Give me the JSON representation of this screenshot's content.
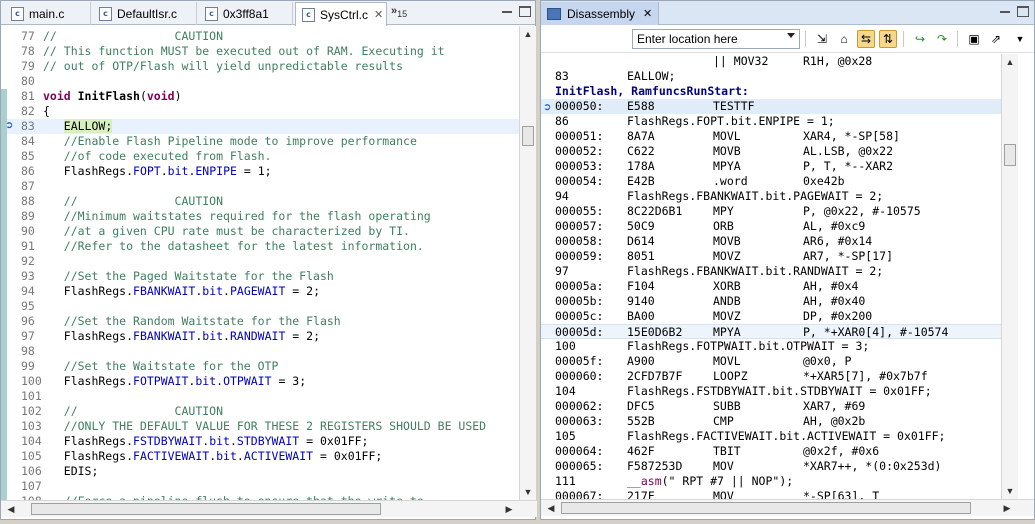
{
  "left_tabs": [
    {
      "label": "main.c",
      "icon": "c-file-icon"
    },
    {
      "label": "DefaultIsr.c",
      "icon": "c-file-icon"
    },
    {
      "label": "0x3ff8a1",
      "icon": "c-file-icon"
    },
    {
      "label": "SysCtrl.c",
      "icon": "c-file-icon",
      "active": true
    }
  ],
  "overflow_tabs": {
    "chevron": "»",
    "count": "15"
  },
  "source_lines": [
    {
      "n": "77",
      "parts": [
        {
          "t": "//                 CAUTION",
          "c": "c-comment"
        }
      ]
    },
    {
      "n": "78",
      "parts": [
        {
          "t": "// This function MUST be executed out of RAM. Executing it",
          "c": "c-comment"
        }
      ]
    },
    {
      "n": "79",
      "parts": [
        {
          "t": "// out of OTP/Flash will yield unpredictable results",
          "c": "c-comment"
        }
      ]
    },
    {
      "n": "80",
      "parts": []
    },
    {
      "n": "81",
      "parts": [
        {
          "t": "void ",
          "c": "c-bold"
        },
        {
          "t": "InitFlash",
          "c": "c-plain c-b"
        },
        {
          "t": "(",
          "c": "c-plain"
        },
        {
          "t": "void",
          "c": "c-bold"
        },
        {
          "t": ")",
          "c": "c-plain"
        }
      ]
    },
    {
      "n": "82",
      "parts": [
        {
          "t": "{",
          "c": "c-plain"
        }
      ]
    },
    {
      "n": "83",
      "parts": [
        {
          "t": "   ",
          "c": "c-plain"
        },
        {
          "t": "EALLOW;",
          "c": "c-plain eallow-hl"
        }
      ],
      "current": true
    },
    {
      "n": "84",
      "parts": [
        {
          "t": "   //Enable Flash Pipeline mode to improve performance",
          "c": "c-comment"
        }
      ]
    },
    {
      "n": "85",
      "parts": [
        {
          "t": "   //of code executed from Flash.",
          "c": "c-comment"
        }
      ]
    },
    {
      "n": "86",
      "parts": [
        {
          "t": "   FlashRegs.",
          "c": "c-plain"
        },
        {
          "t": "FOPT",
          "c": "c-field"
        },
        {
          "t": ".",
          "c": "c-plain"
        },
        {
          "t": "bit",
          "c": "c-field"
        },
        {
          "t": ".",
          "c": "c-plain"
        },
        {
          "t": "ENPIPE",
          "c": "c-field"
        },
        {
          "t": " = 1;",
          "c": "c-plain"
        }
      ]
    },
    {
      "n": "87",
      "parts": []
    },
    {
      "n": "88",
      "parts": [
        {
          "t": "   //              CAUTION",
          "c": "c-comment"
        }
      ]
    },
    {
      "n": "89",
      "parts": [
        {
          "t": "   //Minimum waitstates required for the flash operating",
          "c": "c-comment"
        }
      ]
    },
    {
      "n": "90",
      "parts": [
        {
          "t": "   //at a given CPU rate must be characterized by TI.",
          "c": "c-comment"
        }
      ]
    },
    {
      "n": "91",
      "parts": [
        {
          "t": "   //Refer to the datasheet for the latest information.",
          "c": "c-comment"
        }
      ]
    },
    {
      "n": "92",
      "parts": []
    },
    {
      "n": "93",
      "parts": [
        {
          "t": "   //Set the Paged Waitstate for the Flash",
          "c": "c-comment"
        }
      ]
    },
    {
      "n": "94",
      "parts": [
        {
          "t": "   FlashRegs.",
          "c": "c-plain"
        },
        {
          "t": "FBANKWAIT",
          "c": "c-field"
        },
        {
          "t": ".",
          "c": "c-plain"
        },
        {
          "t": "bit",
          "c": "c-field"
        },
        {
          "t": ".",
          "c": "c-plain"
        },
        {
          "t": "PAGEWAIT",
          "c": "c-field"
        },
        {
          "t": " = 2;",
          "c": "c-plain"
        }
      ]
    },
    {
      "n": "95",
      "parts": []
    },
    {
      "n": "96",
      "parts": [
        {
          "t": "   //Set the Random Waitstate for the Flash",
          "c": "c-comment"
        }
      ]
    },
    {
      "n": "97",
      "parts": [
        {
          "t": "   FlashRegs.",
          "c": "c-plain"
        },
        {
          "t": "FBANKWAIT",
          "c": "c-field"
        },
        {
          "t": ".",
          "c": "c-plain"
        },
        {
          "t": "bit",
          "c": "c-field"
        },
        {
          "t": ".",
          "c": "c-plain"
        },
        {
          "t": "RANDWAIT",
          "c": "c-field"
        },
        {
          "t": " = 2;",
          "c": "c-plain"
        }
      ]
    },
    {
      "n": "98",
      "parts": []
    },
    {
      "n": "99",
      "parts": [
        {
          "t": "   //Set the Waitstate for the OTP",
          "c": "c-comment"
        }
      ]
    },
    {
      "n": "100",
      "parts": [
        {
          "t": "   FlashRegs.",
          "c": "c-plain"
        },
        {
          "t": "FOTPWAIT",
          "c": "c-field"
        },
        {
          "t": ".",
          "c": "c-plain"
        },
        {
          "t": "bit",
          "c": "c-field"
        },
        {
          "t": ".",
          "c": "c-plain"
        },
        {
          "t": "OTPWAIT",
          "c": "c-field"
        },
        {
          "t": " = 3;",
          "c": "c-plain"
        }
      ]
    },
    {
      "n": "101",
      "parts": []
    },
    {
      "n": "102",
      "parts": [
        {
          "t": "   //              CAUTION",
          "c": "c-comment"
        }
      ]
    },
    {
      "n": "103",
      "parts": [
        {
          "t": "   //ONLY THE DEFAULT VALUE FOR THESE 2 REGISTERS SHOULD BE USED",
          "c": "c-comment"
        }
      ]
    },
    {
      "n": "104",
      "parts": [
        {
          "t": "   FlashRegs.",
          "c": "c-plain"
        },
        {
          "t": "FSTDBYWAIT",
          "c": "c-field"
        },
        {
          "t": ".",
          "c": "c-plain"
        },
        {
          "t": "bit",
          "c": "c-field"
        },
        {
          "t": ".",
          "c": "c-plain"
        },
        {
          "t": "STDBYWAIT",
          "c": "c-field"
        },
        {
          "t": " = 0x01FF;",
          "c": "c-plain"
        }
      ]
    },
    {
      "n": "105",
      "parts": [
        {
          "t": "   FlashRegs.",
          "c": "c-plain"
        },
        {
          "t": "FACTIVEWAIT",
          "c": "c-field"
        },
        {
          "t": ".",
          "c": "c-plain"
        },
        {
          "t": "bit",
          "c": "c-field"
        },
        {
          "t": ".",
          "c": "c-plain"
        },
        {
          "t": "ACTIVEWAIT",
          "c": "c-field"
        },
        {
          "t": " = 0x01FF;",
          "c": "c-plain"
        }
      ]
    },
    {
      "n": "106",
      "parts": [
        {
          "t": "   EDIS;",
          "c": "c-plain"
        }
      ]
    },
    {
      "n": "107",
      "parts": []
    },
    {
      "n": "108",
      "parts": [
        {
          "t": "   //Force a pipeline flush to ensure that the write to",
          "c": "c-comment"
        }
      ]
    }
  ],
  "disassembly_tab": {
    "label": "Disassembly"
  },
  "toolbar": {
    "location_placeholder": "Enter location here"
  },
  "dis_lines": [
    {
      "k": "ins",
      "addr": "",
      "op": "",
      "mn": "|| MOV32",
      "arg": "R1H, @0x28"
    },
    {
      "k": "src",
      "num": "83",
      "txt": "EALLOW;"
    },
    {
      "k": "lbl",
      "txt": "InitFlash, RamfuncsRunStart:"
    },
    {
      "k": "ins",
      "addr": "000050:",
      "op": "E588",
      "mn": "TESTTF",
      "arg": "",
      "cur": true
    },
    {
      "k": "src",
      "num": "86",
      "txt": "FlashRegs.FOPT.bit.ENPIPE = 1;"
    },
    {
      "k": "ins",
      "addr": "000051:",
      "op": "8A7A",
      "mn": "MOVL",
      "arg": "XAR4, *-SP[58]"
    },
    {
      "k": "ins",
      "addr": "000052:",
      "op": "C622",
      "mn": "MOVB",
      "arg": "AL.LSB, @0x22"
    },
    {
      "k": "ins",
      "addr": "000053:",
      "op": "178A",
      "mn": "MPYA",
      "arg": "P, T, *--XAR2"
    },
    {
      "k": "ins",
      "addr": "000054:",
      "op": "E42B",
      "mn": ".word",
      "arg": "0xe42b"
    },
    {
      "k": "src",
      "num": "94",
      "txt": "FlashRegs.FBANKWAIT.bit.PAGEWAIT = 2;"
    },
    {
      "k": "ins",
      "addr": "000055:",
      "op": "8C22D6B1",
      "mn": "MPY",
      "arg": "P, @0x22, #-10575"
    },
    {
      "k": "ins",
      "addr": "000057:",
      "op": "50C9",
      "mn": "ORB",
      "arg": "AL, #0xc9"
    },
    {
      "k": "ins",
      "addr": "000058:",
      "op": "D614",
      "mn": "MOVB",
      "arg": "AR6, #0x14"
    },
    {
      "k": "ins",
      "addr": "000059:",
      "op": "8051",
      "mn": "MOVZ",
      "arg": "AR7, *-SP[17]"
    },
    {
      "k": "src",
      "num": "97",
      "txt": "FlashRegs.FBANKWAIT.bit.RANDWAIT = 2;"
    },
    {
      "k": "ins",
      "addr": "00005a:",
      "op": "F104",
      "mn": "XORB",
      "arg": "AH, #0x4"
    },
    {
      "k": "ins",
      "addr": "00005b:",
      "op": "9140",
      "mn": "ANDB",
      "arg": "AH, #0x40"
    },
    {
      "k": "ins",
      "addr": "00005c:",
      "op": "BA00",
      "mn": "MOVZ",
      "arg": "DP, #0x200"
    },
    {
      "k": "ins",
      "addr": "00005d:",
      "op": "15E0D6B2",
      "mn": "MPYA",
      "arg": "P, *+XAR0[4], #-10574",
      "hl": true
    },
    {
      "k": "src",
      "num": "100",
      "txt": "FlashRegs.FOTPWAIT.bit.OTPWAIT = 3;"
    },
    {
      "k": "ins",
      "addr": "00005f:",
      "op": "A900",
      "mn": "MOVL",
      "arg": "@0x0, P"
    },
    {
      "k": "ins",
      "addr": "000060:",
      "op": "2CFD7B7F",
      "mn": "LOOPZ",
      "arg": "*+XAR5[7], #0x7b7f"
    },
    {
      "k": "src",
      "num": "104",
      "txt": "FlashRegs.FSTDBYWAIT.bit.STDBYWAIT = 0x01FF;"
    },
    {
      "k": "ins",
      "addr": "000062:",
      "op": "DFC5",
      "mn": "SUBB",
      "arg": "XAR7, #69"
    },
    {
      "k": "ins",
      "addr": "000063:",
      "op": "552B",
      "mn": "CMP",
      "arg": "AH, @0x2b"
    },
    {
      "k": "src",
      "num": "105",
      "txt": "FlashRegs.FACTIVEWAIT.bit.ACTIVEWAIT = 0x01FF;"
    },
    {
      "k": "ins",
      "addr": "000064:",
      "op": "462F",
      "mn": "TBIT",
      "arg": "@0x2f, #0x6"
    },
    {
      "k": "ins",
      "addr": "000065:",
      "op": "F587253D",
      "mn": "MOV",
      "arg": "*XAR7++, *(0:0x253d)"
    },
    {
      "k": "asm",
      "num": "111",
      "kw": "__asm",
      "txt": "(\" RPT #7 || NOP\");"
    },
    {
      "k": "ins",
      "addr": "000067:",
      "op": "217F",
      "mn": "MOV",
      "arg": "*-SP[63], T"
    }
  ]
}
